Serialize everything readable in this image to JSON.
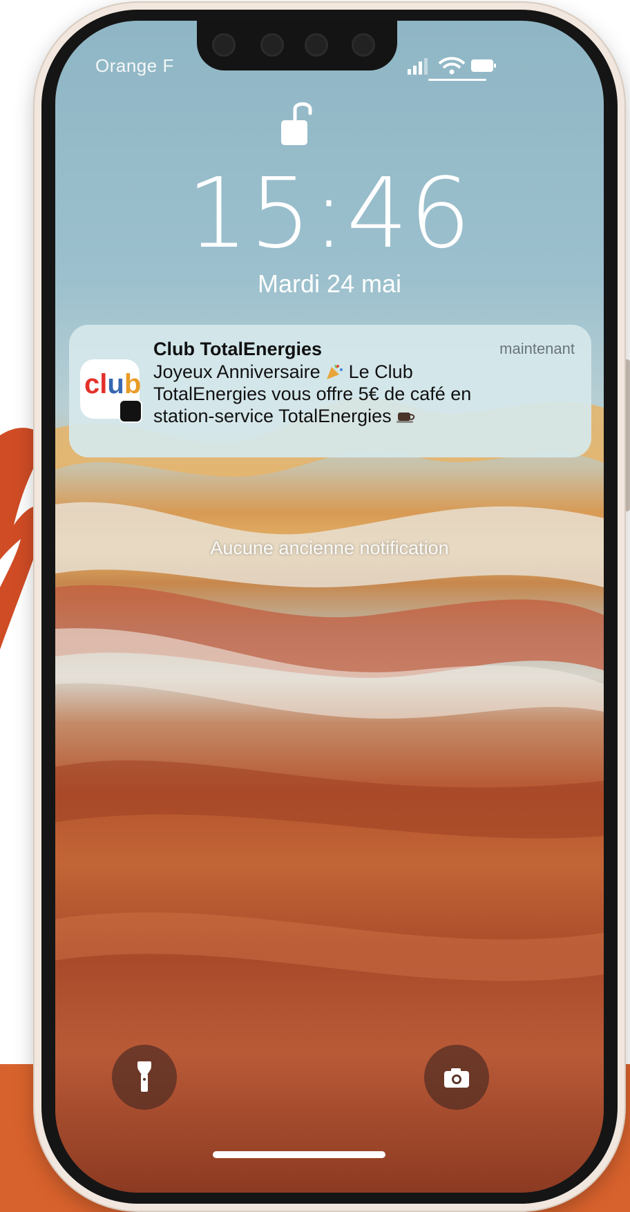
{
  "status_bar": {
    "carrier": "Orange F",
    "icons": [
      "signal-icon",
      "wifi-icon",
      "battery-icon"
    ]
  },
  "lock_screen": {
    "lock_icon": "unlocked-padlock-icon",
    "time": "15:46",
    "date": "Mardi 24 mai"
  },
  "notification": {
    "app_icon": "club-totalenergies-app-icon",
    "app_name": "Club TotalEnergies",
    "timestamp": "maintenant",
    "body_line1_before": "Joyeux Anniversaire ",
    "body_line1_after": " Le Club",
    "body_line2": "TotalEnergies vous offre 5€ de café en",
    "body_line3": "station-service TotalEnergies ",
    "body_emojis": [
      "party-popper-icon",
      "coffee-cup-icon"
    ]
  },
  "older_notifications_text": "Aucune ancienne notification",
  "quick_actions": {
    "left": "flashlight-icon",
    "right": "camera-icon"
  },
  "colors": {
    "accent_orange": "#d8622d",
    "notification_bg": "#d6e8ec",
    "club_red": "#e3322b",
    "club_blue": "#3767b0",
    "club_orange": "#e89c27"
  }
}
